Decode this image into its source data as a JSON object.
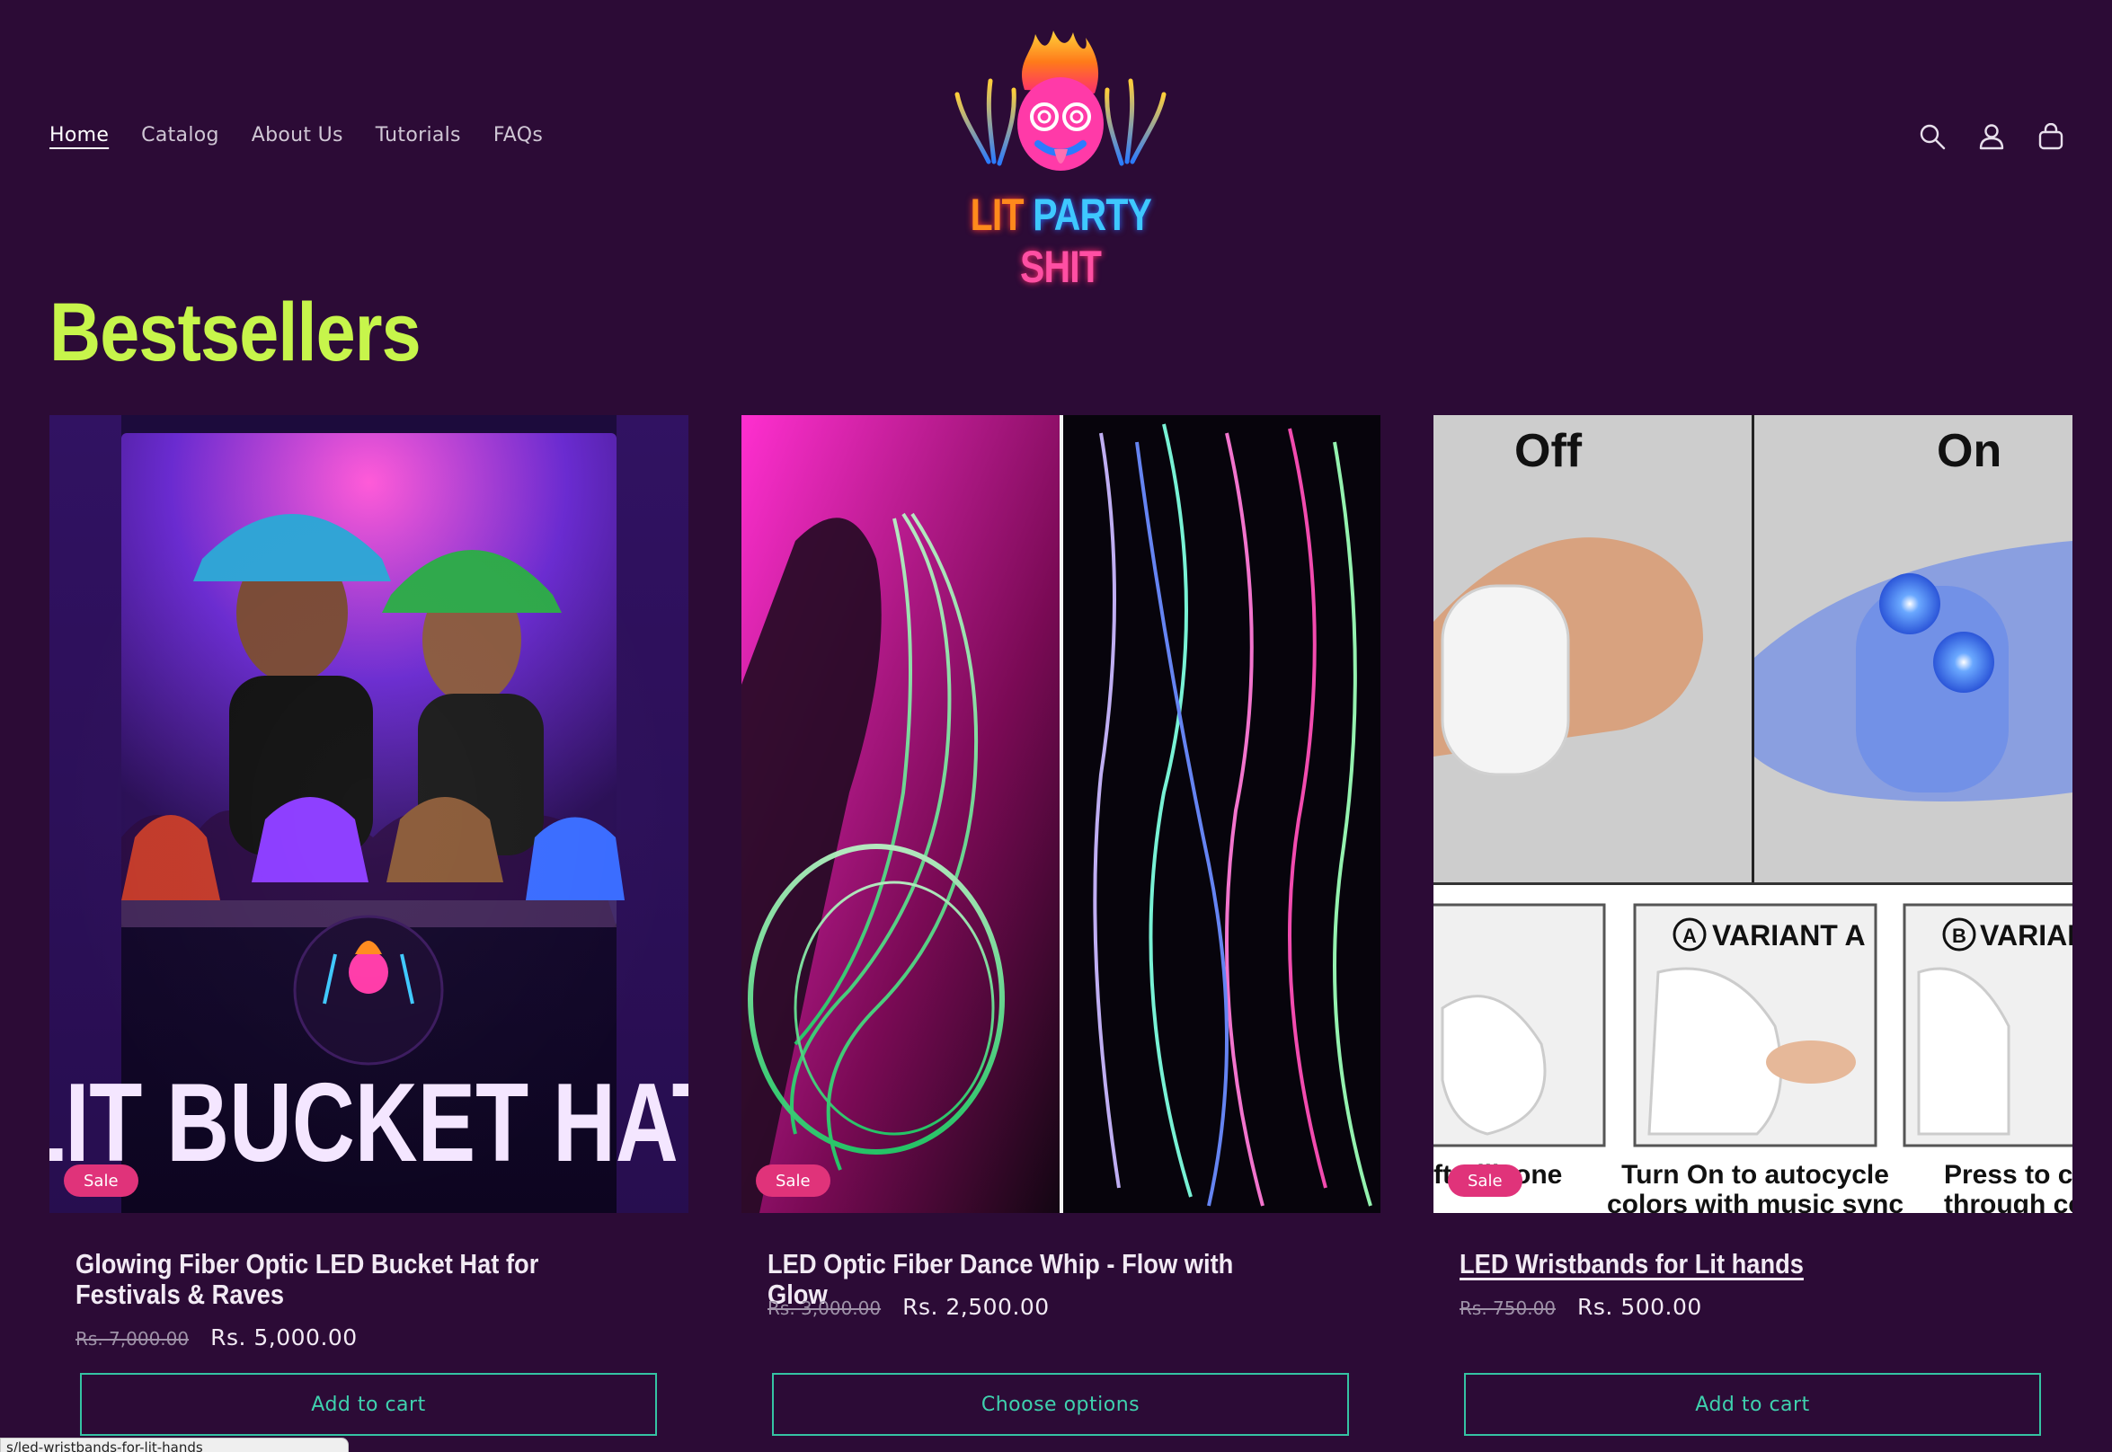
{
  "nav": {
    "items": [
      "Home",
      "Catalog",
      "About Us",
      "Tutorials",
      "FAQs"
    ],
    "active": "Home"
  },
  "brand": {
    "word1": "LIT",
    "word2": "PARTY",
    "word3": "SHIT"
  },
  "header_icons": [
    "search-icon",
    "account-icon",
    "cart-icon"
  ],
  "section": {
    "title": "Bestsellers"
  },
  "products": [
    {
      "image_headline": "LIT BUCKET HAT",
      "badge": "Sale",
      "title": "Glowing Fiber Optic LED Bucket Hat for Festivals & Raves",
      "compare_price": "Rs. 7,000.00",
      "price": "Rs. 5,000.00",
      "cta": "Add to cart"
    },
    {
      "badge": "Sale",
      "title": "LED Optic Fiber Dance Whip - Flow with Glow",
      "compare_price": "Rs. 3,000.00",
      "price": "Rs. 2,500.00",
      "cta": "Choose options"
    },
    {
      "image_labels": {
        "off": "Off",
        "on": "On",
        "variant_a": "VARIANT A",
        "variant_b": "VARIAN",
        "caption_left": "ft Silicone",
        "caption_mid_1": "Turn On to autocycle",
        "caption_mid_2": "colors with music sync",
        "caption_right_1": "Press to cy",
        "caption_right_2": "through col"
      },
      "badge": "Sale",
      "title": "LED Wristbands for Lit hands",
      "compare_price": "Rs. 750.00",
      "price": "Rs. 500.00",
      "cta": "Add to cart"
    }
  ],
  "status_bar": {
    "url": "s/led-wristbands-for-lit-hands"
  },
  "colors": {
    "background": "#2c0b36",
    "heading": "#c7f54b",
    "accent": "#35c3a3",
    "sale_badge": "#e0337a"
  }
}
